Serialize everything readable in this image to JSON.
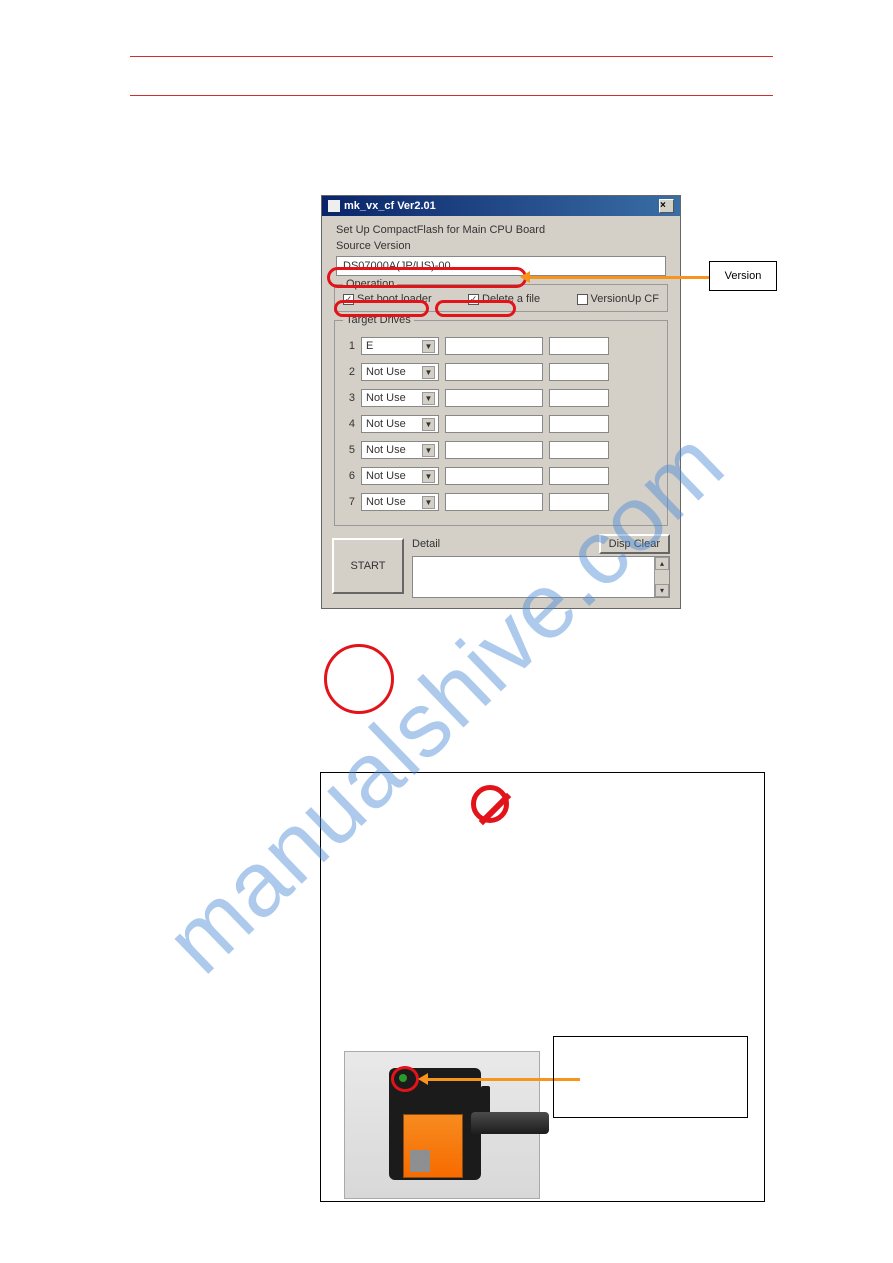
{
  "dialog": {
    "title": "mk_vx_cf Ver2.01",
    "subtitle": "Set Up CompactFlash for Main CPU Board",
    "source_label": "Source Version",
    "version_value": "DS07000A(JP/US)-00",
    "operation": {
      "legend": "Operation",
      "set_boot_loader": {
        "label": "Set boot loader",
        "checked": true
      },
      "delete_file": {
        "label": "Delete a file",
        "checked": true
      },
      "version_up": {
        "label": "VersionUp CF",
        "checked": false
      }
    },
    "target_drives": {
      "legend": "Target Drives",
      "rows": [
        {
          "num": "1",
          "value": "E"
        },
        {
          "num": "2",
          "value": "Not Use"
        },
        {
          "num": "3",
          "value": "Not Use"
        },
        {
          "num": "4",
          "value": "Not Use"
        },
        {
          "num": "5",
          "value": "Not Use"
        },
        {
          "num": "6",
          "value": "Not Use"
        },
        {
          "num": "7",
          "value": "Not Use"
        }
      ]
    },
    "detail_label": "Detail",
    "disp_clear": "Disp Clear",
    "start": "START"
  },
  "callout_version": "Version",
  "placeholder": ""
}
